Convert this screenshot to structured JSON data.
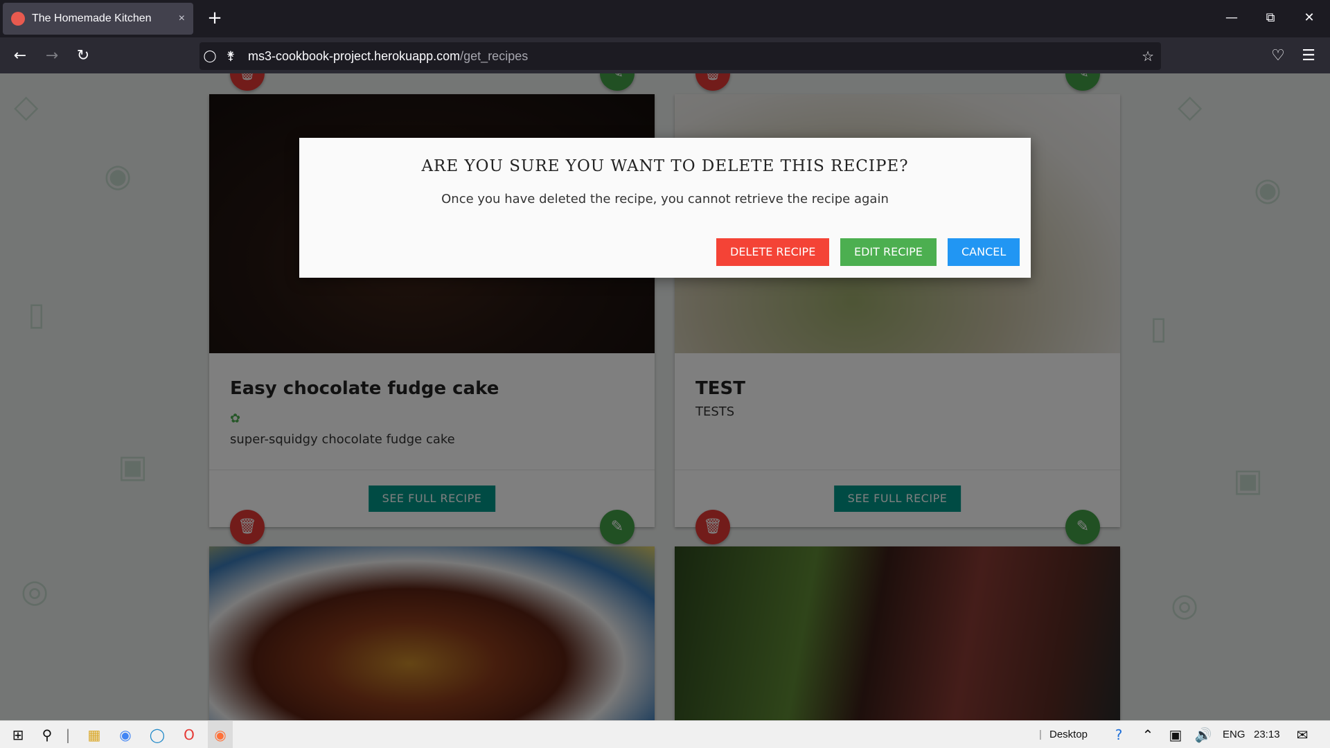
{
  "browser": {
    "tab_title": "The Homemade Kitchen",
    "tab_close": "×",
    "new_tab": "+",
    "url_host": "ms3-cookbook-project.herokuapp.com",
    "url_path": "/get_recipes"
  },
  "modal": {
    "heading": "ARE YOU SURE YOU WANT TO DELETE THIS RECIPE?",
    "message": "Once you have deleted the recipe, you cannot retrieve the recipe again",
    "delete_label": "DELETE RECIPE",
    "edit_label": "EDIT RECIPE",
    "cancel_label": "CANCEL"
  },
  "recipes": [
    {
      "title": "Easy chocolate fudge cake",
      "description": "super-squidgy chocolate fudge cake",
      "button": "SEE FULL RECIPE"
    },
    {
      "title": "TEST",
      "description": "TESTS",
      "button": "SEE FULL RECIPE"
    }
  ],
  "taskbar": {
    "desktop_label": "Desktop",
    "language": "ENG",
    "time": "23:13"
  },
  "colors": {
    "delete": "#f44336",
    "edit": "#4caf50",
    "cancel": "#2196f3",
    "teal": "#009688"
  }
}
